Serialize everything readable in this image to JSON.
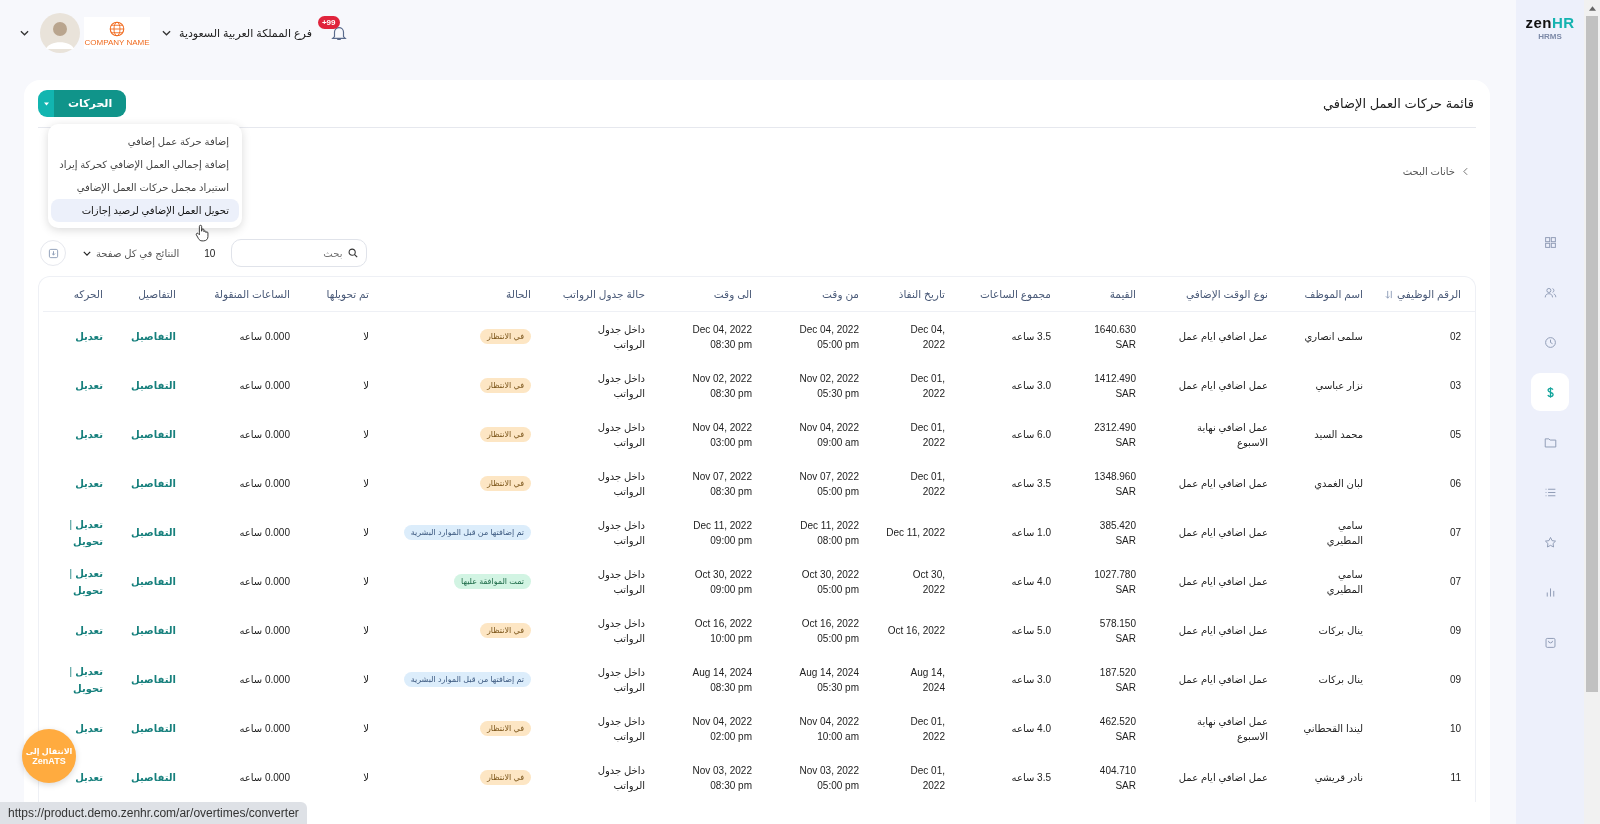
{
  "top_bar": {
    "branch": "فرع المملكة العربية السعودية",
    "notifications_badge": "+99",
    "company_logo_text": "COMPANY NAME"
  },
  "sidebar": {
    "logo": {
      "first": "zen",
      "second": "HR"
    },
    "product": "HRMS",
    "nav": [
      {
        "kind": "grid",
        "selected": false
      },
      {
        "kind": "people",
        "selected": false
      },
      {
        "kind": "clock",
        "selected": false
      },
      {
        "kind": "money",
        "selected": true
      },
      {
        "kind": "folder",
        "selected": false
      },
      {
        "kind": "list",
        "selected": false
      },
      {
        "kind": "star",
        "selected": false
      },
      {
        "kind": "chart",
        "selected": false
      },
      {
        "kind": "bag",
        "selected": false
      }
    ]
  },
  "page": {
    "title": "قائمة حركات العمل الإضافي",
    "actions_button": "الحركات",
    "actions_menu": {
      "expanded": true,
      "items": [
        {
          "label": "إضافة حركة عمل إضافي",
          "selected": false
        },
        {
          "label": "إضافة إجمالي العمل الإضافي كحركة إيراد",
          "selected": false
        },
        {
          "label": "استيراد مجمل حركات العمل الإضافي",
          "selected": false
        },
        {
          "label": "تحويل العمل الإضافي لرصيد إجازات",
          "selected": true
        }
      ]
    },
    "search_filters": "خانات البحث",
    "search": {
      "placeholder": "بحث"
    },
    "page_size": {
      "value": "10",
      "label": "النتائج في كل صفحة"
    }
  },
  "table": {
    "columns": [
      "الرقم الوظيفي",
      "اسم الموظف",
      "نوع الوقت الإضافي",
      "القيمة",
      "مجموع الساعات",
      "تاريخ النفاذ",
      "من وقت",
      "الى وقت",
      "حالة جدول الرواتب",
      "الحالة",
      "تم تحويلها",
      "الساعات المنقولة",
      "التفاصيل",
      "الحركه"
    ],
    "rows": [
      {
        "id": "02",
        "name": "سلمى انصاري",
        "type": "عمل اضافي ايام عمل",
        "value": "1640.630\nSAR",
        "hours": "3.5 ساعه",
        "effective": "Dec 04,\n2022",
        "from": "Dec 04, 2022\n05:00 pm",
        "to": "Dec 04, 2022\n08:30 pm",
        "payroll": "داخل جدول\nالرواتب",
        "status": {
          "label": "في الانتظار",
          "kind": "pending"
        },
        "transferred": "لا",
        "transferred_hours": "0.000 ساعه",
        "details": "التفاصيل",
        "actions": [
          {
            "kind": "link",
            "label": "تعديل"
          }
        ]
      },
      {
        "id": "03",
        "name": "نزار عباسي",
        "type": "عمل اضافي ايام عمل",
        "value": "1412.490\nSAR",
        "hours": "3.0 ساعه",
        "effective": "Dec 01,\n2022",
        "from": "Nov 02, 2022\n05:30 pm",
        "to": "Nov 02, 2022\n08:30 pm",
        "payroll": "داخل جدول\nالرواتب",
        "status": {
          "label": "في الانتظار",
          "kind": "pending"
        },
        "transferred": "لا",
        "transferred_hours": "0.000 ساعه",
        "details": "التفاصيل",
        "actions": [
          {
            "kind": "link",
            "label": "تعديل"
          }
        ]
      },
      {
        "id": "05",
        "name": "محمد السيد",
        "type": "عمل اضافي نهاية\nالاسبوع",
        "value": "2312.490\nSAR",
        "hours": "6.0 ساعه",
        "effective": "Dec 01,\n2022",
        "from": "Nov 04, 2022\n09:00 am",
        "to": "Nov 04, 2022\n03:00 pm",
        "payroll": "داخل جدول\nالرواتب",
        "status": {
          "label": "في الانتظار",
          "kind": "pending"
        },
        "transferred": "لا",
        "transferred_hours": "0.000 ساعه",
        "details": "التفاصيل",
        "actions": [
          {
            "kind": "link",
            "label": "تعديل"
          }
        ]
      },
      {
        "id": "06",
        "name": "لبان الغمدي",
        "type": "عمل اضافي ايام عمل",
        "value": "1348.960\nSAR",
        "hours": "3.5 ساعه",
        "effective": "Dec 01,\n2022",
        "from": "Nov 07, 2022\n05:00 pm",
        "to": "Nov 07, 2022\n08:30 pm",
        "payroll": "داخل جدول\nالرواتب",
        "status": {
          "label": "في الانتظار",
          "kind": "pending"
        },
        "transferred": "لا",
        "transferred_hours": "0.000 ساعه",
        "details": "التفاصيل",
        "actions": [
          {
            "kind": "link",
            "label": "تعديل"
          }
        ]
      },
      {
        "id": "07",
        "name": "سامي\nالمطيري",
        "type": "عمل اضافي ايام عمل",
        "value": "385.420\nSAR",
        "hours": "1.0 ساعه",
        "effective": "Dec 11, 2022",
        "from": "Dec 11, 2022\n08:00 pm",
        "to": "Dec 11, 2022\n09:00 pm",
        "payroll": "داخل جدول\nالرواتب",
        "status": {
          "label": "تم إضافتها من قبل الموارد البشرية",
          "kind": "hr"
        },
        "transferred": "لا",
        "transferred_hours": "0.000 ساعه",
        "details": "التفاصيل",
        "actions": [
          {
            "kind": "link",
            "label": "تعديل"
          },
          {
            "kind": "separator",
            "label": "|"
          },
          {
            "kind": "link",
            "label": "تحويل"
          }
        ]
      },
      {
        "id": "07",
        "name": "سامي\nالمطيري",
        "type": "عمل اضافي ايام عمل",
        "value": "1027.780\nSAR",
        "hours": "4.0 ساعه",
        "effective": "Oct 30,\n2022",
        "from": "Oct 30, 2022\n05:00 pm",
        "to": "Oct 30, 2022\n09:00 pm",
        "payroll": "داخل جدول\nالرواتب",
        "status": {
          "label": "تمت الموافقة عليها",
          "kind": "approved"
        },
        "transferred": "لا",
        "transferred_hours": "0.000 ساعه",
        "details": "التفاصيل",
        "actions": [
          {
            "kind": "link",
            "label": "تعديل"
          },
          {
            "kind": "separator",
            "label": "|"
          },
          {
            "kind": "link",
            "label": "تحويل"
          }
        ]
      },
      {
        "id": "09",
        "name": "ينال بركات",
        "type": "عمل اضافي ايام عمل",
        "value": "578.150\nSAR",
        "hours": "5.0 ساعه",
        "effective": "Oct 16, 2022",
        "from": "Oct 16, 2022\n05:00 pm",
        "to": "Oct 16, 2022\n10:00 pm",
        "payroll": "داخل جدول\nالرواتب",
        "status": {
          "label": "في الانتظار",
          "kind": "pending"
        },
        "transferred": "لا",
        "transferred_hours": "0.000 ساعه",
        "details": "التفاصيل",
        "actions": [
          {
            "kind": "link",
            "label": "تعديل"
          }
        ]
      },
      {
        "id": "09",
        "name": "ينال بركات",
        "type": "عمل اضافي ايام عمل",
        "value": "187.520\nSAR",
        "hours": "3.0 ساعه",
        "effective": "Aug 14,\n2024",
        "from": "Aug 14, 2024\n05:30 pm",
        "to": "Aug 14, 2024\n08:30 pm",
        "payroll": "داخل جدول\nالرواتب",
        "status": {
          "label": "تم إضافتها من قبل الموارد البشرية",
          "kind": "hr"
        },
        "transferred": "لا",
        "transferred_hours": "0.000 ساعه",
        "details": "التفاصيل",
        "actions": [
          {
            "kind": "link",
            "label": "تعديل"
          },
          {
            "kind": "separator",
            "label": "|"
          },
          {
            "kind": "link",
            "label": "تحويل"
          }
        ]
      },
      {
        "id": "10",
        "name": "ليندا القحطاني",
        "type": "عمل اضافي نهاية\nالاسبوع",
        "value": "462.520\nSAR",
        "hours": "4.0 ساعه",
        "effective": "Dec 01,\n2022",
        "from": "Nov 04, 2022\n10:00 am",
        "to": "Nov 04, 2022\n02:00 pm",
        "payroll": "داخل جدول\nالرواتب",
        "status": {
          "label": "في الانتظار",
          "kind": "pending"
        },
        "transferred": "لا",
        "transferred_hours": "0.000 ساعه",
        "details": "التفاصيل",
        "actions": [
          {
            "kind": "link",
            "label": "تعديل"
          }
        ]
      },
      {
        "id": "11",
        "name": "نادر قريشي",
        "type": "عمل اضافي ايام عمل",
        "value": "404.710\nSAR",
        "hours": "3.5 ساعه",
        "effective": "Dec 01,\n2022",
        "from": "Nov 03, 2022\n05:00 pm",
        "to": "Nov 03, 2022\n08:30 pm",
        "payroll": "داخل جدول\nالرواتب",
        "status": {
          "label": "في الانتظار",
          "kind": "pending"
        },
        "transferred": "لا",
        "transferred_hours": "0.000 ساعه",
        "details": "التفاصيل",
        "actions": [
          {
            "kind": "link",
            "label": "تعديل"
          }
        ]
      }
    ]
  },
  "ats_button": {
    "caption": "الانتقال إلى",
    "product": "ZenATS"
  },
  "status_url": "https://product.demo.zenhr.com/ar/overtimes/converter"
}
